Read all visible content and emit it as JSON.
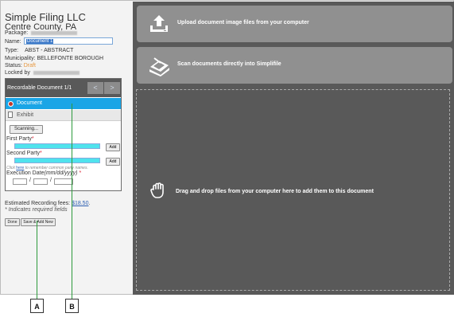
{
  "sidebar": {
    "company": "Simple Filing LLC",
    "county": "Centre County, PA",
    "package_label": "Package:",
    "name_label": "Name:",
    "name_value": "Document 1",
    "type_label": "Type:",
    "type_value": "ABST - ABSTRACT",
    "municipality_label": "Municipality:",
    "municipality_value": "BELLEFONTE BOROUGH",
    "status_label": "Status:",
    "status_value": "Draft",
    "locked_label": "Locked by"
  },
  "document_panel": {
    "title": "Recordable Document 1/1",
    "prev_label": "<",
    "next_label": ">",
    "items": [
      {
        "label": "Document"
      },
      {
        "label": "Exhibit"
      }
    ],
    "scanning_label": "Scanning...",
    "first_party_label": "First Party",
    "second_party_label": "Second Party",
    "required_mark": "*",
    "add_label": "Add",
    "hint_prefix": "Click",
    "hint_link": "here",
    "hint_suffix": "to remember common party names.",
    "execution_date_label": "Execution Date",
    "execution_date_format": "(mm/dd/yyyy)",
    "date_separator": "/"
  },
  "fees": {
    "label": "Estimated Recording fees:",
    "amount": "$18.50",
    "period": ".",
    "required_note": "* Indicates required fields"
  },
  "buttons": {
    "done": "Done",
    "save_add_new": "Save & Add New"
  },
  "main": {
    "upload_text": "Upload document image files from your computer",
    "scan_text": "Scan documents directly into Simplifile",
    "drop_text": "Drag and drop files from your computer here to add them to this document"
  },
  "callouts": {
    "a": "A",
    "b": "B"
  },
  "colors": {
    "accent": "#1aa5e6",
    "panel_dark": "#595959",
    "action_button": "#909090",
    "party_input": "#4fe3ed",
    "status_draft": "#e7963c",
    "callout_line": "#2d9a3c"
  },
  "icons": {
    "upload": "upload-icon",
    "scan": "scanner-icon",
    "drop": "hand-icon",
    "document": "radio-selected-icon",
    "exhibit": "page-icon"
  }
}
